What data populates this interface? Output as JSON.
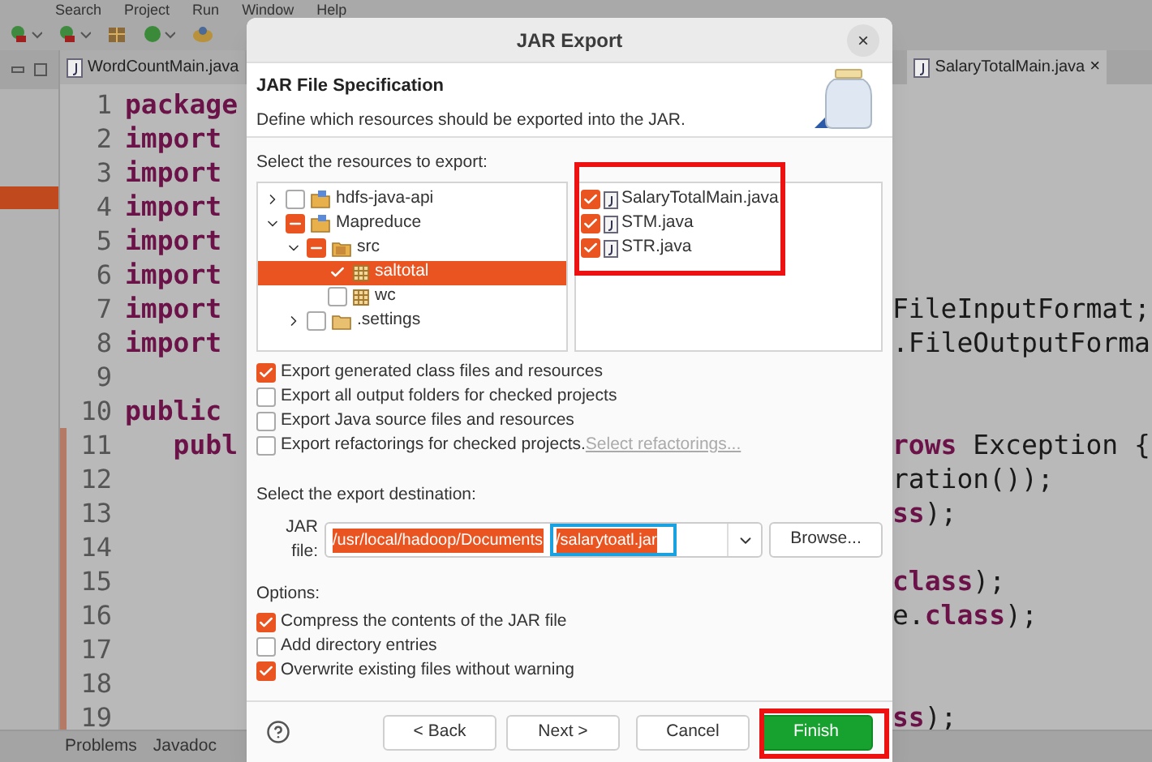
{
  "menu_bar": [
    "Search",
    "Project",
    "Run",
    "Window",
    "Help"
  ],
  "editor_tabs": [
    {
      "label": "WordCountMain.java",
      "selected": false
    },
    {
      "label": "SalaryTotalMain.java",
      "selected": true,
      "close": "×"
    }
  ],
  "code_lines": [
    {
      "number": "1",
      "left": "package",
      "modified": false
    },
    {
      "number": "2",
      "left": "import",
      "modified": false
    },
    {
      "number": "3",
      "left": "import",
      "modified": false
    },
    {
      "number": "4",
      "left": "import",
      "modified": false
    },
    {
      "number": "5",
      "left": "import",
      "modified": false
    },
    {
      "number": "6",
      "left": "import",
      "modified": false
    },
    {
      "number": "7",
      "left": "import",
      "right": "FileInputFormat;",
      "modified": false
    },
    {
      "number": "8",
      "left": "import",
      "right": ".FileOutputForma",
      "modified": false
    },
    {
      "number": "9",
      "modified": false
    },
    {
      "number": "10",
      "left": "public",
      "modified": false
    },
    {
      "number": "11",
      "left": "   publ",
      "right": "**rows** Exception {",
      "modified": true
    },
    {
      "number": "12",
      "right": "ration());",
      "modified": true
    },
    {
      "number": "13",
      "right": "**ss**);",
      "modified": true
    },
    {
      "number": "14",
      "modified": true
    },
    {
      "number": "15",
      "right": "**class**);",
      "modified": true
    },
    {
      "number": "16",
      "right": "e.**class**);",
      "modified": true
    },
    {
      "number": "17",
      "modified": true
    },
    {
      "number": "18",
      "modified": true
    },
    {
      "number": "19",
      "right": "**ss**);",
      "modified": true
    }
  ],
  "bottom_tabs": [
    "Problems",
    "Javadoc"
  ],
  "dialog": {
    "title": "JAR Export",
    "close": "×",
    "heading": "JAR File Specification",
    "description": "Define which resources should be exported into the JAR.",
    "resources_label": "Select the resources to export:",
    "tree": [
      {
        "label": "hdfs-java-api",
        "kind": "project",
        "checked": false,
        "partial": false,
        "expanded": false,
        "selected": false
      },
      {
        "label": "Mapreduce",
        "kind": "project",
        "checked": true,
        "partial": true,
        "expanded": true,
        "selected": false,
        "children": [
          {
            "label": "src",
            "kind": "source",
            "checked": true,
            "partial": true,
            "expanded": true,
            "selected": false,
            "children": [
              {
                "label": "saltotal",
                "kind": "package",
                "checked": true,
                "partial": false,
                "selected": true
              },
              {
                "label": "wc",
                "kind": "package",
                "checked": false,
                "partial": false,
                "selected": false
              }
            ]
          },
          {
            "label": ".settings",
            "kind": "folder",
            "checked": false,
            "partial": false,
            "expanded": false,
            "selected": false
          }
        ]
      }
    ],
    "files": [
      {
        "name": "SalaryTotalMain.java",
        "checked": true
      },
      {
        "name": "STM.java",
        "checked": true
      },
      {
        "name": "STR.java",
        "checked": true
      }
    ],
    "export_options": [
      {
        "label": "Export generated class files and resources",
        "checked": true
      },
      {
        "label": "Export all output folders for checked projects",
        "checked": false
      },
      {
        "label": "Export Java source files and resources",
        "checked": false
      },
      {
        "label": "Export refactorings for checked projects.",
        "checked": false,
        "link": "Select refactorings..."
      }
    ],
    "destination_label": "Select the export destination:",
    "jar_file_label": "JAR file:",
    "jar_path": "/usr/local/hadoop/Documents",
    "jar_name": "/salarytoatl.jar",
    "browse": "Browse...",
    "options_label": "Options:",
    "options": [
      {
        "label": "Compress the contents of the JAR file",
        "checked": true
      },
      {
        "label": "Add directory entries",
        "checked": false
      },
      {
        "label": "Overwrite existing files without warning",
        "checked": true
      }
    ],
    "buttons": [
      {
        "label": "< Back",
        "kind": "normal"
      },
      {
        "label": "Next >",
        "kind": "normal"
      },
      {
        "label": "Cancel",
        "kind": "normal"
      },
      {
        "label": "Finish",
        "kind": "primary"
      }
    ]
  }
}
